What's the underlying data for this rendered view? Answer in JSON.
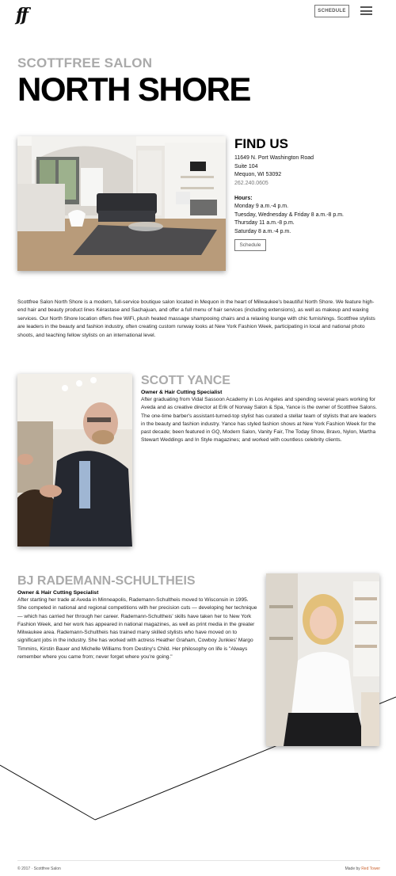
{
  "header": {
    "logo": "ff",
    "schedule_label": "SCHEDULE",
    "menu_icon": "hamburger-menu-icon"
  },
  "hero": {
    "subtitle": "SCOTTFREE SALON",
    "title": "NORTH SHORE"
  },
  "find_us": {
    "heading": "FIND US",
    "address_line1": "11649 N. Port Washington Road",
    "address_line2": "Suite 104",
    "address_line3": "Mequon, WI 53092",
    "phone": "262.240.0605",
    "hours_label": "Hours:",
    "hours": [
      "Monday 9 a.m.-4 p.m.",
      "Tuesday, Wednesday & Friday 8 a.m.-8 p.m.",
      "Thursday 11 a.m.-8 p.m.",
      "Saturday 8 a.m.-4 p.m."
    ],
    "schedule_button": "Schedule"
  },
  "intro": "Scottfree Salon North Shore is a modern, full-service boutique salon located in Mequon in the heart of Milwaukee's beautiful North Shore. We feature high-end hair and beauty product lines Kérastase and Sachajuan, and offer a full menu of hair services (including extensions), as well as makeup and waxing services. Our North Shore location offers free WiFi, plush heated massage shampooing chairs and a relaxing lounge with chic furnishings. Scottfree stylists are leaders in the beauty and fashion industry, often creating custom runway looks at New York Fashion Week, participating in local and national photo shoots, and teaching fellow stylists on an international level.",
  "stylists": [
    {
      "name": "SCOTT YANCE",
      "role": "Owner & Hair Cutting Specialist",
      "bio": "After graduating from Vidal Sassoon Academy in Los Angeles and spending several years working for Aveda and as creative director at Erik of Norway Salon & Spa, Yance is the owner of Scottfree Salons. The one-time barber's assistant-turned-top stylist has curated a stellar team of stylists that are leaders in the beauty and fashion industry. Yance has styled fashion shows at New York Fashion Week for the past decade; been featured in GQ, Modern Salon, Vanity Fair, The Today Show, Bravo, Nylon, Martha Stewart Weddings and In Style magazines; and worked with countless celebrity clients."
    },
    {
      "name": "BJ RADEMANN-SCHULTHEIS",
      "role": "Owner & Hair Cutting Specialist",
      "bio": "After starting her trade at Aveda in Minneapolis, Rademann-Schultheis moved to Wisconsin in 1995. She competed in national and regional competitions with her precision cuts — developing her technique — which has carried her through her career. Rademann-Schultheis' skills have taken her to New York Fashion Week, and her work has appeared in national magazines, as well as print media in the greater Milwaukee area. Rademann-Schultheis has trained many skilled stylists who have moved on to significant jobs in the industry. She has worked with actress Heather Graham, Cowboy Junkies' Margo Timmins, Kirstin Bauer and Michelle Williams from Destiny's Child. Her philosophy on life is \"Always remember where you came from; never forget where you're going.\""
    }
  ],
  "footer": {
    "copyright": "© 2017 · Scottfree Salon",
    "made_by_prefix": "Made by",
    "made_by_link": "Red Tower"
  }
}
